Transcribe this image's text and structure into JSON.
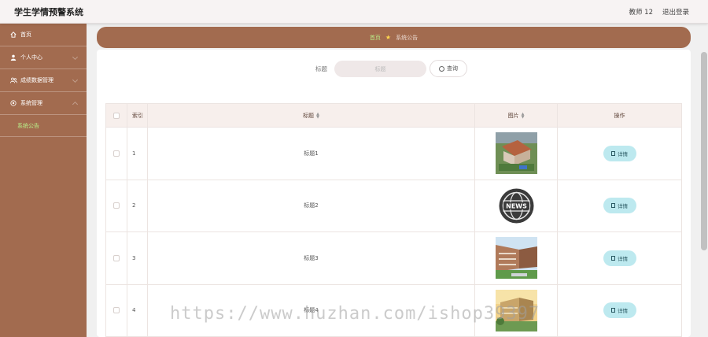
{
  "app": {
    "title": "学生学情预警系统"
  },
  "header": {
    "user": "教师 12",
    "logout": "退出登录"
  },
  "sidebar": {
    "items": [
      {
        "label": "首页",
        "icon": "home-icon"
      },
      {
        "label": "个人中心",
        "icon": "user-icon"
      },
      {
        "label": "成绩数据管理",
        "icon": "users-icon"
      },
      {
        "label": "系统管理",
        "icon": "settings-icon",
        "submenu": [
          {
            "label": "系统公告"
          }
        ]
      }
    ]
  },
  "breadcrumb": {
    "home": "首页",
    "current": "系统公告"
  },
  "search": {
    "label": "标题",
    "placeholder": "标题",
    "button": "查询"
  },
  "table": {
    "headers": {
      "index": "索引",
      "title": "标题",
      "image": "图片",
      "action": "操作"
    },
    "rows": [
      {
        "index": "1",
        "title": "标题1",
        "image": "campus-aerial",
        "action": "详情"
      },
      {
        "index": "2",
        "title": "标题2",
        "image": "news-globe",
        "action": "详情"
      },
      {
        "index": "3",
        "title": "标题3",
        "image": "school-building",
        "action": "详情"
      },
      {
        "index": "4",
        "title": "标题4",
        "image": "campus-sunset",
        "action": "详情"
      }
    ]
  },
  "watermark": "https://www.huzhan.com/ishop39397",
  "colors": {
    "sidebar": "#a26b4f",
    "accent_green": "#b9f08a",
    "detail_button": "#bde9ef"
  }
}
